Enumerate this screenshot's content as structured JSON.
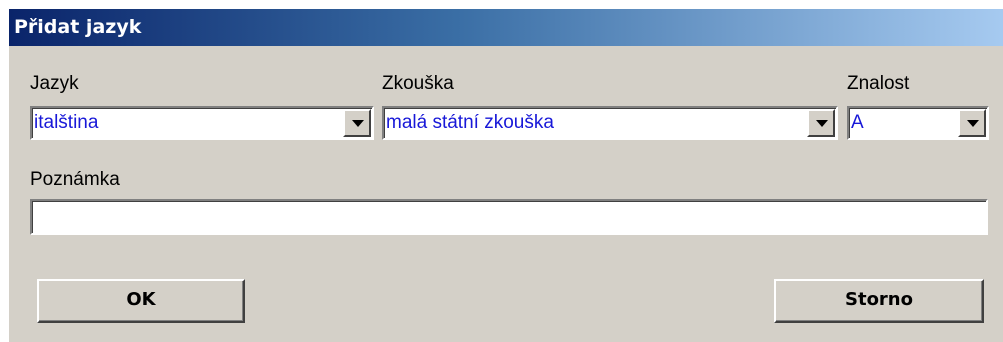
{
  "window": {
    "title": "Přidat jazyk"
  },
  "form": {
    "language": {
      "label": "Jazyk",
      "value": "italština"
    },
    "exam": {
      "label": "Zkouška",
      "value": "malá státní zkouška"
    },
    "level": {
      "label": "Znalost",
      "value": "A"
    },
    "note": {
      "label": "Poznámka",
      "value": ""
    }
  },
  "buttons": {
    "ok_label": "OK",
    "cancel_label": "Storno"
  },
  "colors": {
    "title_start": "#0a246a",
    "title_end": "#a6caf0",
    "dialog_bg": "#d4d0c8",
    "combo_text": "#1818d8"
  }
}
